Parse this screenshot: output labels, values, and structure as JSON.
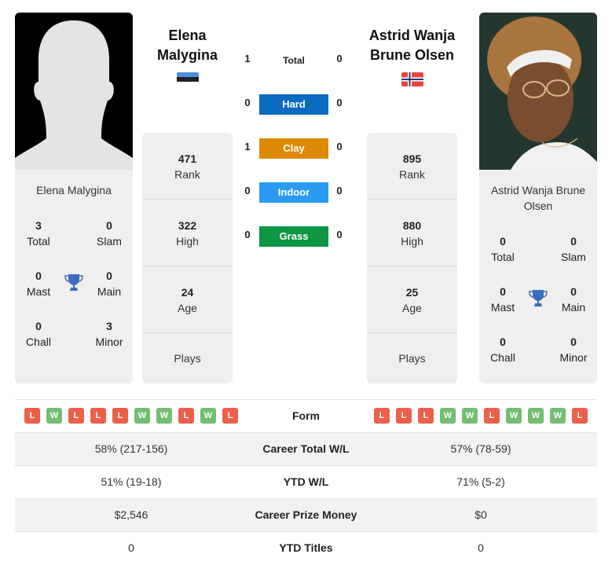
{
  "player1": {
    "name": "Elena Malygina",
    "name_line1": "Elena",
    "name_line2": "Malygina",
    "country_flag": "estonia-flag",
    "titles": {
      "total": {
        "value": "3",
        "label": "Total"
      },
      "slam": {
        "value": "0",
        "label": "Slam"
      },
      "mast": {
        "value": "0",
        "label": "Mast"
      },
      "main": {
        "value": "0",
        "label": "Main"
      },
      "chall": {
        "value": "0",
        "label": "Chall"
      },
      "minor": {
        "value": "3",
        "label": "Minor"
      }
    },
    "stats": {
      "rank": {
        "value": "471",
        "label": "Rank"
      },
      "high": {
        "value": "322",
        "label": "High"
      },
      "age": {
        "value": "24",
        "label": "Age"
      },
      "plays": {
        "value": "",
        "label": "Plays"
      }
    }
  },
  "player2": {
    "name": "Astrid Wanja Brune Olsen",
    "name_line1": "Astrid Wanja",
    "name_line2": "Brune Olsen",
    "country_flag": "norway-flag",
    "titles": {
      "total": {
        "value": "0",
        "label": "Total"
      },
      "slam": {
        "value": "0",
        "label": "Slam"
      },
      "mast": {
        "value": "0",
        "label": "Mast"
      },
      "main": {
        "value": "0",
        "label": "Main"
      },
      "chall": {
        "value": "0",
        "label": "Chall"
      },
      "minor": {
        "value": "0",
        "label": "Minor"
      }
    },
    "stats": {
      "rank": {
        "value": "895",
        "label": "Rank"
      },
      "high": {
        "value": "880",
        "label": "High"
      },
      "age": {
        "value": "25",
        "label": "Age"
      },
      "plays": {
        "value": "",
        "label": "Plays"
      }
    }
  },
  "h2h": [
    {
      "label": "Total",
      "p1": "1",
      "p2": "0",
      "color": ""
    },
    {
      "label": "Hard",
      "p1": "0",
      "p2": "0",
      "color": "#0b6bc2"
    },
    {
      "label": "Clay",
      "p1": "1",
      "p2": "0",
      "color": "#dd8a06"
    },
    {
      "label": "Indoor",
      "p1": "0",
      "p2": "0",
      "color": "#2a9bf0"
    },
    {
      "label": "Grass",
      "p1": "0",
      "p2": "0",
      "color": "#0e9642"
    }
  ],
  "comparison": {
    "form_label": "Form",
    "p1_form": [
      "L",
      "W",
      "L",
      "L",
      "L",
      "W",
      "W",
      "L",
      "W",
      "L"
    ],
    "p2_form": [
      "L",
      "L",
      "L",
      "W",
      "W",
      "L",
      "W",
      "W",
      "W",
      "L"
    ],
    "rows": [
      {
        "label": "Career Total W/L",
        "p1": "58% (217-156)",
        "p2": "57% (78-59)"
      },
      {
        "label": "YTD W/L",
        "p1": "51% (19-18)",
        "p2": "71% (5-2)"
      },
      {
        "label": "Career Prize Money",
        "p1": "$2,546",
        "p2": "$0"
      },
      {
        "label": "YTD Titles",
        "p1": "0",
        "p2": "0"
      }
    ]
  },
  "colors": {
    "loss": "#ec5f4a",
    "win": "#74bd72",
    "trophy": "#3b6fbd"
  }
}
